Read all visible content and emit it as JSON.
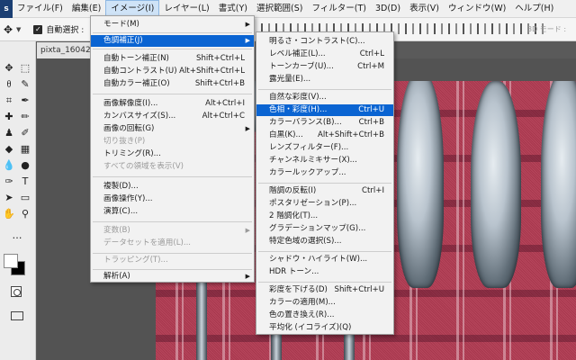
{
  "menubar": {
    "logo": "s",
    "items": [
      "ファイル(F)",
      "編集(E)",
      "イメージ(I)",
      "レイヤー(L)",
      "書式(Y)",
      "選択範囲(S)",
      "フィルター(T)",
      "3D(D)",
      "表示(V)",
      "ウィンドウ(W)",
      "ヘルプ(H)"
    ]
  },
  "options_bar": {
    "auto_select_label": "自動選択 :",
    "mode_3d_label": "3D モード :",
    "auto_select_checked": true
  },
  "document": {
    "tab_title": "pixta_160429"
  },
  "toolbar": {
    "tools": [
      "move-icon",
      "marquee-icon",
      "lasso-icon",
      "quick-select-icon",
      "crop-icon",
      "eyedropper-icon",
      "healing-brush-icon",
      "brush-icon",
      "clone-stamp-icon",
      "history-brush-icon",
      "eraser-icon",
      "gradient-icon",
      "blur-icon",
      "dodge-icon",
      "pen-icon",
      "type-icon",
      "path-select-icon",
      "rectangle-icon",
      "hand-icon",
      "zoom-icon",
      "more-icon"
    ],
    "foreground_color": "#ffffff",
    "background_color": "#000000"
  },
  "image_menu": {
    "items": [
      {
        "label": "モード(M)",
        "shortcut": "",
        "submenu": true,
        "disabled": false
      },
      {
        "label": "色調補正(J)",
        "shortcut": "",
        "submenu": true,
        "disabled": false,
        "highlight": true
      },
      {
        "label": "自動トーン補正(N)",
        "shortcut": "Shift+Ctrl+L",
        "disabled": false
      },
      {
        "label": "自動コントラスト(U)",
        "shortcut": "Alt+Shift+Ctrl+L",
        "disabled": false
      },
      {
        "label": "自動カラー補正(O)",
        "shortcut": "Shift+Ctrl+B",
        "disabled": false
      },
      {
        "label": "画像解像度(I)...",
        "shortcut": "Alt+Ctrl+I",
        "disabled": false
      },
      {
        "label": "カンバスサイズ(S)...",
        "shortcut": "Alt+Ctrl+C",
        "disabled": false
      },
      {
        "label": "画像の回転(G)",
        "shortcut": "",
        "submenu": true,
        "disabled": false
      },
      {
        "label": "切り抜き(P)",
        "shortcut": "",
        "disabled": true
      },
      {
        "label": "トリミング(R)...",
        "shortcut": "",
        "disabled": false
      },
      {
        "label": "すべての領域を表示(V)",
        "shortcut": "",
        "disabled": true
      },
      {
        "label": "複製(D)...",
        "shortcut": "",
        "disabled": false
      },
      {
        "label": "画像操作(Y)...",
        "shortcut": "",
        "disabled": false
      },
      {
        "label": "演算(C)...",
        "shortcut": "",
        "disabled": false
      },
      {
        "label": "変数(B)",
        "shortcut": "",
        "submenu": true,
        "disabled": true
      },
      {
        "label": "データセットを適用(L)...",
        "shortcut": "",
        "disabled": true
      },
      {
        "label": "トラッピング(T)...",
        "shortcut": "",
        "disabled": true
      },
      {
        "label": "解析(A)",
        "shortcut": "",
        "submenu": true,
        "disabled": false
      }
    ]
  },
  "adjustments_menu": {
    "items": [
      {
        "label": "明るさ・コントラスト(C)...",
        "shortcut": ""
      },
      {
        "label": "レベル補正(L)...",
        "shortcut": "Ctrl+L"
      },
      {
        "label": "トーンカーブ(U)...",
        "shortcut": "Ctrl+M"
      },
      {
        "label": "露光量(E)...",
        "shortcut": ""
      },
      {
        "label": "自然な彩度(V)...",
        "shortcut": ""
      },
      {
        "label": "色相・彩度(H)...",
        "shortcut": "Ctrl+U",
        "highlight": true
      },
      {
        "label": "カラーバランス(B)...",
        "shortcut": "Ctrl+B"
      },
      {
        "label": "白黒(K)...",
        "shortcut": "Alt+Shift+Ctrl+B"
      },
      {
        "label": "レンズフィルター(F)...",
        "shortcut": ""
      },
      {
        "label": "チャンネルミキサー(X)...",
        "shortcut": ""
      },
      {
        "label": "カラールックアップ...",
        "shortcut": ""
      },
      {
        "label": "階調の反転(I)",
        "shortcut": "Ctrl+I"
      },
      {
        "label": "ポスタリゼーション(P)...",
        "shortcut": ""
      },
      {
        "label": "2 階調化(T)...",
        "shortcut": ""
      },
      {
        "label": "グラデーションマップ(G)...",
        "shortcut": ""
      },
      {
        "label": "特定色域の選択(S)...",
        "shortcut": ""
      },
      {
        "label": "シャドウ・ハイライト(W)...",
        "shortcut": ""
      },
      {
        "label": "HDR トーン...",
        "shortcut": ""
      },
      {
        "label": "彩度を下げる(D)",
        "shortcut": "Shift+Ctrl+U"
      },
      {
        "label": "カラーの適用(M)...",
        "shortcut": ""
      },
      {
        "label": "色の置き換え(R)...",
        "shortcut": ""
      },
      {
        "label": "平均化 (イコライズ)(Q)",
        "shortcut": ""
      }
    ]
  }
}
